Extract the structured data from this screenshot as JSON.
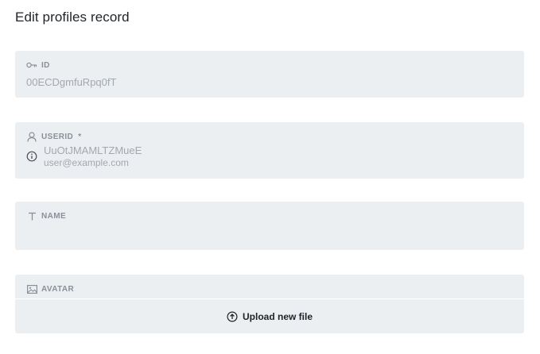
{
  "page": {
    "title": "Edit profiles record"
  },
  "fields": {
    "id": {
      "label": "ID",
      "icon": "key-icon",
      "value": "00ECDgmfuRpq0fT"
    },
    "userid": {
      "label": "USERID",
      "required_mark": "*",
      "icon": "user-icon",
      "relation_icon": "info-icon",
      "primary": "UuOtJMAMLTZMueE",
      "secondary": "user@example.com"
    },
    "name": {
      "label": "NAME",
      "icon": "text-icon",
      "value": ""
    },
    "avatar": {
      "label": "AVATAR",
      "icon": "image-icon",
      "upload_label": "Upload new file",
      "upload_icon": "upload-cloud-icon"
    }
  },
  "colors": {
    "field_bg": "#eceff2",
    "label": "#8a8f98",
    "muted_value": "#a3a8b0",
    "text": "#1f2328"
  }
}
